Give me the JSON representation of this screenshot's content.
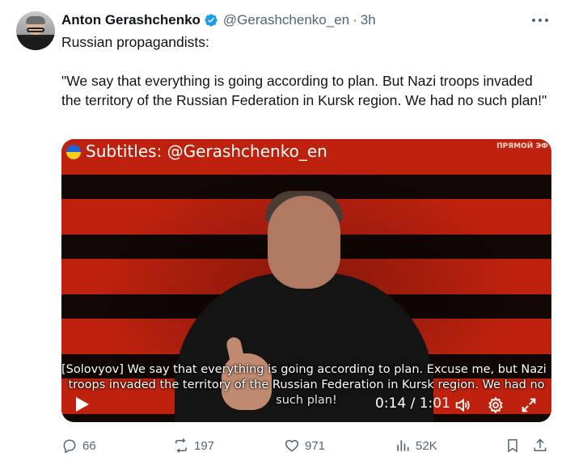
{
  "author": {
    "name": "Anton Gerashchenko",
    "handle": "@Gerashchenko_en",
    "separator": "·",
    "time": "3h",
    "verified_icon": "verified-badge-icon",
    "verified_color": "#1d9bf0"
  },
  "tweet": {
    "line1": "Russian propagandists:",
    "quote": "\"We say that everything is going according to plan. But Nazi troops invaded the territory of the Russian Federation in Kursk region. We had no such plan!\""
  },
  "video": {
    "subtitle_label": "Subtitles: @Gerashchenko_en",
    "live_label": "ПРЯМОЙ ЭФ",
    "caption_line1": "[Solovyov] We say that everything is going according to plan. Excuse me, but Nazi",
    "caption_line2": "troops invaded the territory of the Russian Federation in Kursk region. We had no",
    "caption_line3": "such plan!",
    "timecode": "0:14 / 1:01",
    "icons": [
      "play-icon",
      "volume-icon",
      "settings-gear-icon",
      "fullscreen-icon"
    ]
  },
  "actions": {
    "replies": "66",
    "reposts": "197",
    "likes": "971",
    "views": "52K"
  },
  "colors": {
    "text": "#0f1419",
    "secondary": "#536471",
    "stripe_red": "#c8230f"
  }
}
